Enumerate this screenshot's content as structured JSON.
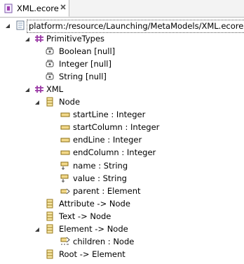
{
  "editor": {
    "tab_title": "XML.ecore"
  },
  "tree": {
    "root": "platform:/resource/Launching/MetaModels/XML.ecore",
    "packages": [
      {
        "name": "PrimitiveTypes",
        "datatypes": [
          "Boolean [null]",
          "Integer [null]",
          "String [null]"
        ]
      },
      {
        "name": "XML",
        "node_class": "Node",
        "node_features": [
          "startLine : Integer",
          "startColumn : Integer",
          "endLine : Integer",
          "endColumn : Integer",
          "name : String",
          "value : String",
          "parent : Element"
        ],
        "classes": [
          "Attribute -> Node",
          "Text -> Node",
          "Element -> Node",
          "Root -> Element"
        ],
        "element_features": [
          "children : Node"
        ]
      }
    ]
  }
}
